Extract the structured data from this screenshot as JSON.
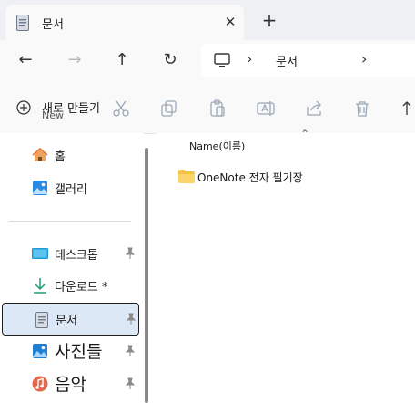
{
  "tab": {
    "title": "문서",
    "icon": "document-icon",
    "close_label": "✕",
    "new_tab_label": "+"
  },
  "nav": {
    "back": "←",
    "forward": "→",
    "up": "↑",
    "refresh": "↻",
    "address": {
      "icon": "computer-icon",
      "separator": "›",
      "location": "문서",
      "separator_end": "›"
    }
  },
  "toolbar": {
    "new_label": "새로 만들기",
    "new_label_en": "New",
    "tools": [
      "cut-icon",
      "copy-icon",
      "paste-icon",
      "rename-icon",
      "share-icon",
      "delete-icon",
      "sort-icon"
    ]
  },
  "sidebar": {
    "items": [
      {
        "label": "홈",
        "icon": "home-icon",
        "pinned": false,
        "selected": false
      },
      {
        "label": "갤러리",
        "icon": "gallery-icon",
        "pinned": false,
        "selected": false
      },
      {
        "label": "데스크톱",
        "icon": "desktop-icon",
        "pinned": true,
        "selected": false
      },
      {
        "label": "다운로드 *",
        "icon": "download-icon",
        "pinned": false,
        "selected": false
      },
      {
        "label": "문서",
        "icon": "documents-icon",
        "pinned": true,
        "selected": true
      },
      {
        "label": "사진들",
        "icon": "pictures-icon",
        "pinned": true,
        "selected": false
      },
      {
        "label": "음악",
        "icon": "music-icon",
        "pinned": true,
        "selected": false
      }
    ]
  },
  "content": {
    "sort_caret": "⌃",
    "column_name": "Name(이름)",
    "files": [
      {
        "name": "OneNote 전자 필기장",
        "type": "folder"
      }
    ]
  },
  "colors": {
    "accent": "#0067c0",
    "selected_bg": "#dce8f5",
    "folder": "#f5c344"
  }
}
